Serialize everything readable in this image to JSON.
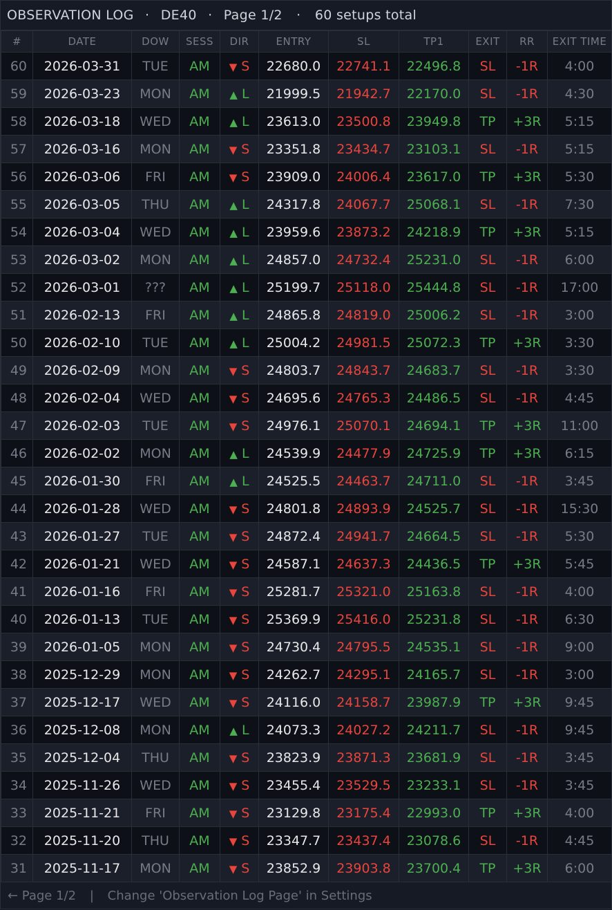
{
  "title": {
    "log_name": "OBSERVATION LOG",
    "symbol": "DE40",
    "page": "Page 1/2",
    "total": "60 setups total",
    "dot": "·"
  },
  "columns": [
    "#",
    "DATE",
    "DOW",
    "SESS",
    "DIR",
    "ENTRY",
    "SL",
    "TP1",
    "EXIT",
    "RR",
    "EXIT TIME"
  ],
  "colors": {
    "background": "#131722",
    "loss_red": "#e8453c",
    "profit_green": "#4caf50",
    "muted": "#787b86"
  },
  "icons": {
    "long": "up-triangle-icon",
    "short": "down-triangle-icon"
  },
  "rows": [
    {
      "num": "60",
      "date": "2026-03-31",
      "dow": "TUE",
      "sess": "AM",
      "dir": "S",
      "entry": "22680.0",
      "sl": "22741.1",
      "tp1": "22496.8",
      "exit": "SL",
      "rr": "-1R",
      "exit_time": "4:00"
    },
    {
      "num": "59",
      "date": "2026-03-23",
      "dow": "MON",
      "sess": "AM",
      "dir": "L",
      "entry": "21999.5",
      "sl": "21942.7",
      "tp1": "22170.0",
      "exit": "SL",
      "rr": "-1R",
      "exit_time": "4:30"
    },
    {
      "num": "58",
      "date": "2026-03-18",
      "dow": "WED",
      "sess": "AM",
      "dir": "L",
      "entry": "23613.0",
      "sl": "23500.8",
      "tp1": "23949.8",
      "exit": "TP",
      "rr": "+3R",
      "exit_time": "5:15"
    },
    {
      "num": "57",
      "date": "2026-03-16",
      "dow": "MON",
      "sess": "AM",
      "dir": "S",
      "entry": "23351.8",
      "sl": "23434.7",
      "tp1": "23103.1",
      "exit": "SL",
      "rr": "-1R",
      "exit_time": "5:15"
    },
    {
      "num": "56",
      "date": "2026-03-06",
      "dow": "FRI",
      "sess": "AM",
      "dir": "S",
      "entry": "23909.0",
      "sl": "24006.4",
      "tp1": "23617.0",
      "exit": "TP",
      "rr": "+3R",
      "exit_time": "5:30"
    },
    {
      "num": "55",
      "date": "2026-03-05",
      "dow": "THU",
      "sess": "AM",
      "dir": "L",
      "entry": "24317.8",
      "sl": "24067.7",
      "tp1": "25068.1",
      "exit": "SL",
      "rr": "-1R",
      "exit_time": "7:30"
    },
    {
      "num": "54",
      "date": "2026-03-04",
      "dow": "WED",
      "sess": "AM",
      "dir": "L",
      "entry": "23959.6",
      "sl": "23873.2",
      "tp1": "24218.9",
      "exit": "TP",
      "rr": "+3R",
      "exit_time": "5:15"
    },
    {
      "num": "53",
      "date": "2026-03-02",
      "dow": "MON",
      "sess": "AM",
      "dir": "L",
      "entry": "24857.0",
      "sl": "24732.4",
      "tp1": "25231.0",
      "exit": "SL",
      "rr": "-1R",
      "exit_time": "6:00"
    },
    {
      "num": "52",
      "date": "2026-03-01",
      "dow": "???",
      "sess": "AM",
      "dir": "L",
      "entry": "25199.7",
      "sl": "25118.0",
      "tp1": "25444.8",
      "exit": "SL",
      "rr": "-1R",
      "exit_time": "17:00"
    },
    {
      "num": "51",
      "date": "2026-02-13",
      "dow": "FRI",
      "sess": "AM",
      "dir": "L",
      "entry": "24865.8",
      "sl": "24819.0",
      "tp1": "25006.2",
      "exit": "SL",
      "rr": "-1R",
      "exit_time": "3:00"
    },
    {
      "num": "50",
      "date": "2026-02-10",
      "dow": "TUE",
      "sess": "AM",
      "dir": "L",
      "entry": "25004.2",
      "sl": "24981.5",
      "tp1": "25072.3",
      "exit": "TP",
      "rr": "+3R",
      "exit_time": "3:30"
    },
    {
      "num": "49",
      "date": "2026-02-09",
      "dow": "MON",
      "sess": "AM",
      "dir": "S",
      "entry": "24803.7",
      "sl": "24843.7",
      "tp1": "24683.7",
      "exit": "SL",
      "rr": "-1R",
      "exit_time": "3:30"
    },
    {
      "num": "48",
      "date": "2026-02-04",
      "dow": "WED",
      "sess": "AM",
      "dir": "S",
      "entry": "24695.6",
      "sl": "24765.3",
      "tp1": "24486.5",
      "exit": "SL",
      "rr": "-1R",
      "exit_time": "4:45"
    },
    {
      "num": "47",
      "date": "2026-02-03",
      "dow": "TUE",
      "sess": "AM",
      "dir": "S",
      "entry": "24976.1",
      "sl": "25070.1",
      "tp1": "24694.1",
      "exit": "TP",
      "rr": "+3R",
      "exit_time": "11:00"
    },
    {
      "num": "46",
      "date": "2026-02-02",
      "dow": "MON",
      "sess": "AM",
      "dir": "L",
      "entry": "24539.9",
      "sl": "24477.9",
      "tp1": "24725.9",
      "exit": "TP",
      "rr": "+3R",
      "exit_time": "6:15"
    },
    {
      "num": "45",
      "date": "2026-01-30",
      "dow": "FRI",
      "sess": "AM",
      "dir": "L",
      "entry": "24525.5",
      "sl": "24463.7",
      "tp1": "24711.0",
      "exit": "SL",
      "rr": "-1R",
      "exit_time": "3:45"
    },
    {
      "num": "44",
      "date": "2026-01-28",
      "dow": "WED",
      "sess": "AM",
      "dir": "S",
      "entry": "24801.8",
      "sl": "24893.9",
      "tp1": "24525.7",
      "exit": "SL",
      "rr": "-1R",
      "exit_time": "15:30"
    },
    {
      "num": "43",
      "date": "2026-01-27",
      "dow": "TUE",
      "sess": "AM",
      "dir": "S",
      "entry": "24872.4",
      "sl": "24941.7",
      "tp1": "24664.5",
      "exit": "SL",
      "rr": "-1R",
      "exit_time": "5:30"
    },
    {
      "num": "42",
      "date": "2026-01-21",
      "dow": "WED",
      "sess": "AM",
      "dir": "S",
      "entry": "24587.1",
      "sl": "24637.3",
      "tp1": "24436.5",
      "exit": "TP",
      "rr": "+3R",
      "exit_time": "5:45"
    },
    {
      "num": "41",
      "date": "2026-01-16",
      "dow": "FRI",
      "sess": "AM",
      "dir": "S",
      "entry": "25281.7",
      "sl": "25321.0",
      "tp1": "25163.8",
      "exit": "SL",
      "rr": "-1R",
      "exit_time": "4:00"
    },
    {
      "num": "40",
      "date": "2026-01-13",
      "dow": "TUE",
      "sess": "AM",
      "dir": "S",
      "entry": "25369.9",
      "sl": "25416.0",
      "tp1": "25231.8",
      "exit": "SL",
      "rr": "-1R",
      "exit_time": "6:30"
    },
    {
      "num": "39",
      "date": "2026-01-05",
      "dow": "MON",
      "sess": "AM",
      "dir": "S",
      "entry": "24730.4",
      "sl": "24795.5",
      "tp1": "24535.1",
      "exit": "SL",
      "rr": "-1R",
      "exit_time": "9:00"
    },
    {
      "num": "38",
      "date": "2025-12-29",
      "dow": "MON",
      "sess": "AM",
      "dir": "S",
      "entry": "24262.7",
      "sl": "24295.1",
      "tp1": "24165.7",
      "exit": "SL",
      "rr": "-1R",
      "exit_time": "3:00"
    },
    {
      "num": "37",
      "date": "2025-12-17",
      "dow": "WED",
      "sess": "AM",
      "dir": "S",
      "entry": "24116.0",
      "sl": "24158.7",
      "tp1": "23987.9",
      "exit": "TP",
      "rr": "+3R",
      "exit_time": "9:45"
    },
    {
      "num": "36",
      "date": "2025-12-08",
      "dow": "MON",
      "sess": "AM",
      "dir": "L",
      "entry": "24073.3",
      "sl": "24027.2",
      "tp1": "24211.7",
      "exit": "SL",
      "rr": "-1R",
      "exit_time": "9:45"
    },
    {
      "num": "35",
      "date": "2025-12-04",
      "dow": "THU",
      "sess": "AM",
      "dir": "S",
      "entry": "23823.9",
      "sl": "23871.3",
      "tp1": "23681.9",
      "exit": "SL",
      "rr": "-1R",
      "exit_time": "3:45"
    },
    {
      "num": "34",
      "date": "2025-11-26",
      "dow": "WED",
      "sess": "AM",
      "dir": "S",
      "entry": "23455.4",
      "sl": "23529.5",
      "tp1": "23233.1",
      "exit": "SL",
      "rr": "-1R",
      "exit_time": "3:45"
    },
    {
      "num": "33",
      "date": "2025-11-21",
      "dow": "FRI",
      "sess": "AM",
      "dir": "S",
      "entry": "23129.8",
      "sl": "23175.4",
      "tp1": "22993.0",
      "exit": "TP",
      "rr": "+3R",
      "exit_time": "4:00"
    },
    {
      "num": "32",
      "date": "2025-11-20",
      "dow": "THU",
      "sess": "AM",
      "dir": "S",
      "entry": "23347.7",
      "sl": "23437.4",
      "tp1": "23078.6",
      "exit": "SL",
      "rr": "-1R",
      "exit_time": "4:45"
    },
    {
      "num": "31",
      "date": "2025-11-17",
      "dow": "MON",
      "sess": "AM",
      "dir": "S",
      "entry": "23852.9",
      "sl": "23903.8",
      "tp1": "23700.4",
      "exit": "TP",
      "rr": "+3R",
      "exit_time": "6:00"
    }
  ],
  "footer": {
    "nav": "← Page 1/2",
    "divider": "|",
    "hint": "Change 'Observation Log Page' in Settings"
  }
}
